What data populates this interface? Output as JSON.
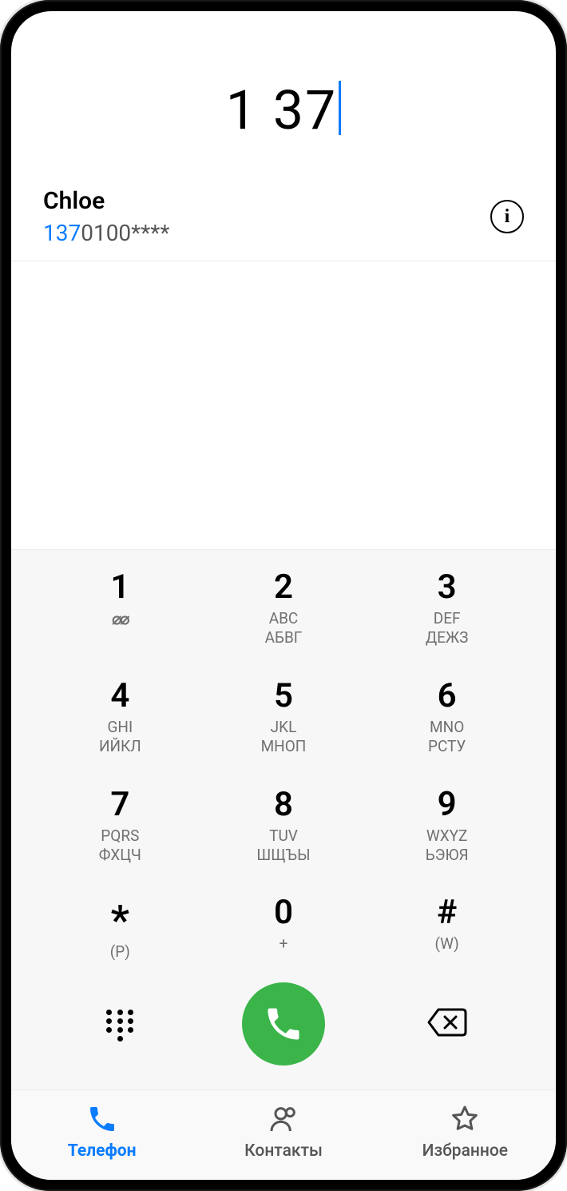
{
  "accent": "#0a7cff",
  "dialed": "1 37",
  "suggestion": {
    "name": "Chloe",
    "number_highlight": "137",
    "number_rest": "0100****"
  },
  "keypad": [
    {
      "digit": "1",
      "sub": "",
      "sub2": ""
    },
    {
      "digit": "2",
      "sub": "ABC",
      "sub2": "АБВГ"
    },
    {
      "digit": "3",
      "sub": "DEF",
      "sub2": "ДЕЖЗ"
    },
    {
      "digit": "4",
      "sub": "GHI",
      "sub2": "ИЙКЛ"
    },
    {
      "digit": "5",
      "sub": "JKL",
      "sub2": "МНОП"
    },
    {
      "digit": "6",
      "sub": "MNO",
      "sub2": "РСТУ"
    },
    {
      "digit": "7",
      "sub": "PQRS",
      "sub2": "ФХЦЧ"
    },
    {
      "digit": "8",
      "sub": "TUV",
      "sub2": "ШЩЪЫ"
    },
    {
      "digit": "9",
      "sub": "WXYZ",
      "sub2": "ЬЭЮЯ"
    },
    {
      "digit": "*",
      "sub": "(P)",
      "sub2": ""
    },
    {
      "digit": "0",
      "sub": "+",
      "sub2": ""
    },
    {
      "digit": "#",
      "sub": "(W)",
      "sub2": ""
    }
  ],
  "nav": {
    "phone": "Телефон",
    "contacts": "Контакты",
    "favorites": "Избранное"
  }
}
